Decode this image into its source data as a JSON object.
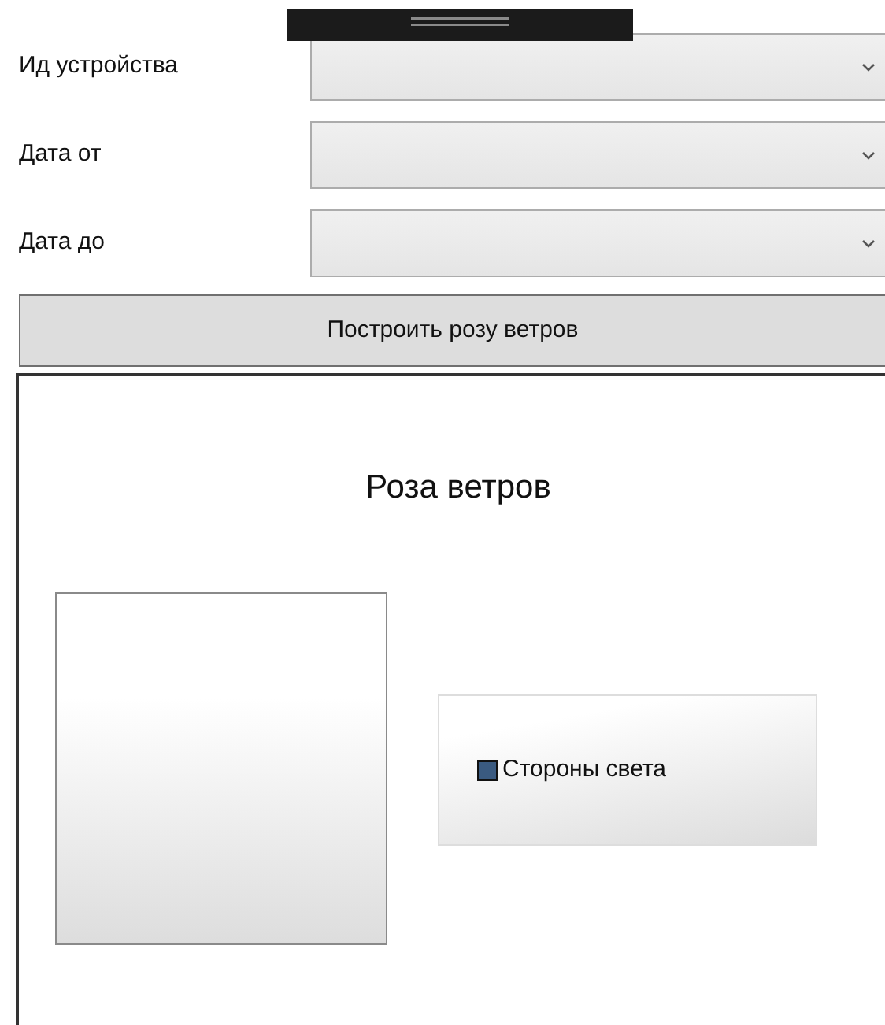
{
  "fields": [
    {
      "label": "Ид устройства"
    },
    {
      "label": "Дата от"
    },
    {
      "label": "Дата до"
    }
  ],
  "build_button": "Построить розу ветров",
  "chart": {
    "title": "Роза ветров",
    "legend": [
      {
        "label": "Стороны света",
        "color": "#3a5a80"
      }
    ]
  }
}
